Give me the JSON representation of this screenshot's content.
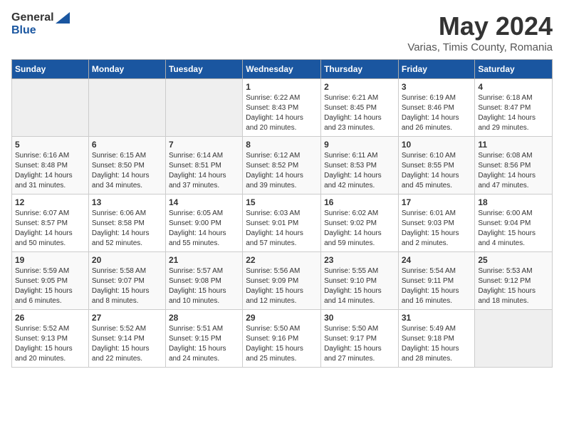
{
  "header": {
    "logo_general": "General",
    "logo_blue": "Blue",
    "title": "May 2024",
    "subtitle": "Varias, Timis County, Romania"
  },
  "calendar": {
    "weekdays": [
      "Sunday",
      "Monday",
      "Tuesday",
      "Wednesday",
      "Thursday",
      "Friday",
      "Saturday"
    ],
    "weeks": [
      [
        {
          "day": "",
          "info": ""
        },
        {
          "day": "",
          "info": ""
        },
        {
          "day": "",
          "info": ""
        },
        {
          "day": "1",
          "info": "Sunrise: 6:22 AM\nSunset: 8:43 PM\nDaylight: 14 hours\nand 20 minutes."
        },
        {
          "day": "2",
          "info": "Sunrise: 6:21 AM\nSunset: 8:45 PM\nDaylight: 14 hours\nand 23 minutes."
        },
        {
          "day": "3",
          "info": "Sunrise: 6:19 AM\nSunset: 8:46 PM\nDaylight: 14 hours\nand 26 minutes."
        },
        {
          "day": "4",
          "info": "Sunrise: 6:18 AM\nSunset: 8:47 PM\nDaylight: 14 hours\nand 29 minutes."
        }
      ],
      [
        {
          "day": "5",
          "info": "Sunrise: 6:16 AM\nSunset: 8:48 PM\nDaylight: 14 hours\nand 31 minutes."
        },
        {
          "day": "6",
          "info": "Sunrise: 6:15 AM\nSunset: 8:50 PM\nDaylight: 14 hours\nand 34 minutes."
        },
        {
          "day": "7",
          "info": "Sunrise: 6:14 AM\nSunset: 8:51 PM\nDaylight: 14 hours\nand 37 minutes."
        },
        {
          "day": "8",
          "info": "Sunrise: 6:12 AM\nSunset: 8:52 PM\nDaylight: 14 hours\nand 39 minutes."
        },
        {
          "day": "9",
          "info": "Sunrise: 6:11 AM\nSunset: 8:53 PM\nDaylight: 14 hours\nand 42 minutes."
        },
        {
          "day": "10",
          "info": "Sunrise: 6:10 AM\nSunset: 8:55 PM\nDaylight: 14 hours\nand 45 minutes."
        },
        {
          "day": "11",
          "info": "Sunrise: 6:08 AM\nSunset: 8:56 PM\nDaylight: 14 hours\nand 47 minutes."
        }
      ],
      [
        {
          "day": "12",
          "info": "Sunrise: 6:07 AM\nSunset: 8:57 PM\nDaylight: 14 hours\nand 50 minutes."
        },
        {
          "day": "13",
          "info": "Sunrise: 6:06 AM\nSunset: 8:58 PM\nDaylight: 14 hours\nand 52 minutes."
        },
        {
          "day": "14",
          "info": "Sunrise: 6:05 AM\nSunset: 9:00 PM\nDaylight: 14 hours\nand 55 minutes."
        },
        {
          "day": "15",
          "info": "Sunrise: 6:03 AM\nSunset: 9:01 PM\nDaylight: 14 hours\nand 57 minutes."
        },
        {
          "day": "16",
          "info": "Sunrise: 6:02 AM\nSunset: 9:02 PM\nDaylight: 14 hours\nand 59 minutes."
        },
        {
          "day": "17",
          "info": "Sunrise: 6:01 AM\nSunset: 9:03 PM\nDaylight: 15 hours\nand 2 minutes."
        },
        {
          "day": "18",
          "info": "Sunrise: 6:00 AM\nSunset: 9:04 PM\nDaylight: 15 hours\nand 4 minutes."
        }
      ],
      [
        {
          "day": "19",
          "info": "Sunrise: 5:59 AM\nSunset: 9:05 PM\nDaylight: 15 hours\nand 6 minutes."
        },
        {
          "day": "20",
          "info": "Sunrise: 5:58 AM\nSunset: 9:07 PM\nDaylight: 15 hours\nand 8 minutes."
        },
        {
          "day": "21",
          "info": "Sunrise: 5:57 AM\nSunset: 9:08 PM\nDaylight: 15 hours\nand 10 minutes."
        },
        {
          "day": "22",
          "info": "Sunrise: 5:56 AM\nSunset: 9:09 PM\nDaylight: 15 hours\nand 12 minutes."
        },
        {
          "day": "23",
          "info": "Sunrise: 5:55 AM\nSunset: 9:10 PM\nDaylight: 15 hours\nand 14 minutes."
        },
        {
          "day": "24",
          "info": "Sunrise: 5:54 AM\nSunset: 9:11 PM\nDaylight: 15 hours\nand 16 minutes."
        },
        {
          "day": "25",
          "info": "Sunrise: 5:53 AM\nSunset: 9:12 PM\nDaylight: 15 hours\nand 18 minutes."
        }
      ],
      [
        {
          "day": "26",
          "info": "Sunrise: 5:52 AM\nSunset: 9:13 PM\nDaylight: 15 hours\nand 20 minutes."
        },
        {
          "day": "27",
          "info": "Sunrise: 5:52 AM\nSunset: 9:14 PM\nDaylight: 15 hours\nand 22 minutes."
        },
        {
          "day": "28",
          "info": "Sunrise: 5:51 AM\nSunset: 9:15 PM\nDaylight: 15 hours\nand 24 minutes."
        },
        {
          "day": "29",
          "info": "Sunrise: 5:50 AM\nSunset: 9:16 PM\nDaylight: 15 hours\nand 25 minutes."
        },
        {
          "day": "30",
          "info": "Sunrise: 5:50 AM\nSunset: 9:17 PM\nDaylight: 15 hours\nand 27 minutes."
        },
        {
          "day": "31",
          "info": "Sunrise: 5:49 AM\nSunset: 9:18 PM\nDaylight: 15 hours\nand 28 minutes."
        },
        {
          "day": "",
          "info": ""
        }
      ]
    ]
  }
}
